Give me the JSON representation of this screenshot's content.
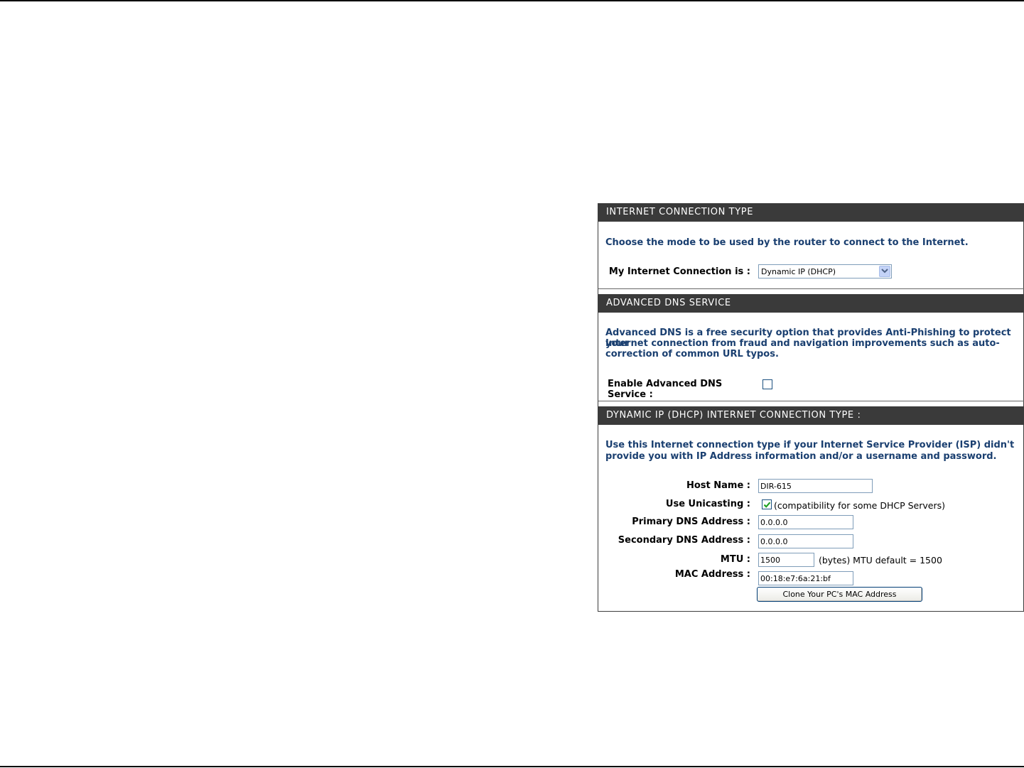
{
  "internet_connection_type": {
    "header": "INTERNET CONNECTION TYPE",
    "description": "Choose the mode to be used by the router to connect to the Internet.",
    "connection_label": "My Internet Connection is :",
    "connection_value": "Dynamic IP (DHCP)"
  },
  "advanced_dns": {
    "header": "ADVANCED DNS SERVICE",
    "description_line1": "Advanced DNS is a free security option that provides Anti-Phishing to protect your",
    "description_line2": "Internet connection from fraud and navigation improvements such as auto-",
    "description_line3": "correction of common URL typos.",
    "enable_label": "Enable Advanced DNS Service :",
    "enabled": false
  },
  "dhcp": {
    "header": "DYNAMIC IP (DHCP) INTERNET CONNECTION TYPE :",
    "description_line1": "Use this Internet connection type if your Internet Service Provider (ISP) didn't",
    "description_line2": "provide you with IP Address information and/or a username and password.",
    "host_name_label": "Host Name :",
    "host_name_value": "DIR-615",
    "unicasting_label": "Use Unicasting :",
    "unicasting_checked": true,
    "unicasting_note": "(compatibility for some DHCP Servers)",
    "primary_dns_label": "Primary DNS Address :",
    "primary_dns_value": "0.0.0.0",
    "secondary_dns_label": "Secondary DNS Address :",
    "secondary_dns_value": "0.0.0.0",
    "mtu_label": "MTU :",
    "mtu_value": "1500",
    "mtu_note": "(bytes) MTU default = 1500",
    "mac_label": "MAC Address :",
    "mac_value": "00:18:e7:6a:21:bf",
    "clone_button": "Clone Your PC's MAC Address"
  },
  "colors": {
    "header_bg": "#3a3a3a",
    "description_text": "#1a3f70"
  }
}
